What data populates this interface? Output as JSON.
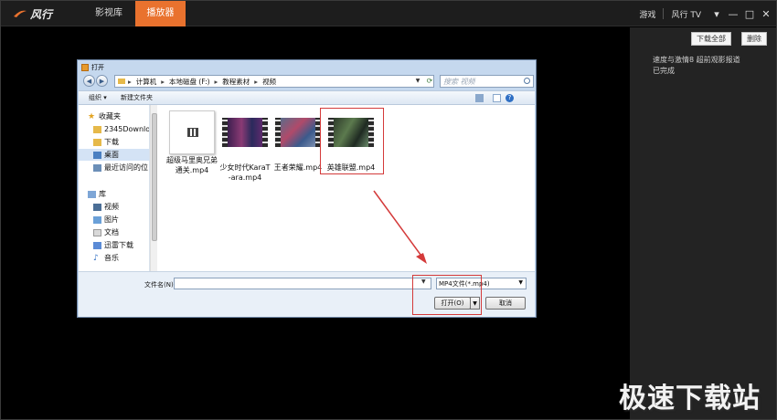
{
  "app": {
    "logo_text": "风行",
    "tabs": [
      {
        "label": "影视库"
      },
      {
        "label": "播放器"
      }
    ],
    "top_right": {
      "game": "游戏",
      "tv": "风行 TV"
    }
  },
  "right_panel": {
    "download_all": "下载全部",
    "delete": "删除",
    "item_title": "速度与激情8 超前观影报道",
    "item_status": "已完成"
  },
  "dialog": {
    "title": "打开",
    "breadcrumb": [
      "计算机",
      "本地磁盘 (F:)",
      "教程素材",
      "视频"
    ],
    "search_placeholder": "搜索 视频",
    "toolbar": {
      "organize": "组织 ▾",
      "new_folder": "新建文件夹"
    },
    "sidebar": [
      {
        "label": "收藏夹",
        "icon": "star-icon"
      },
      {
        "label": "2345Downlo",
        "icon": "folder-icon"
      },
      {
        "label": "下载",
        "icon": "folder-icon"
      },
      {
        "label": "桌面",
        "icon": "desktop-icon",
        "selected": true
      },
      {
        "label": "最近访问的位",
        "icon": "recent-icon"
      },
      {
        "label": "库",
        "icon": "library-icon"
      },
      {
        "label": "视频",
        "icon": "video-icon"
      },
      {
        "label": "图片",
        "icon": "picture-icon"
      },
      {
        "label": "文档",
        "icon": "document-icon"
      },
      {
        "label": "迅雷下载",
        "icon": "folder-icon"
      },
      {
        "label": "音乐",
        "icon": "music-icon"
      }
    ],
    "files": [
      {
        "name": "超级马里奥兄弟通关.mp4",
        "type": "document"
      },
      {
        "name": "少女时代KaraT-ara.mp4",
        "type": "video"
      },
      {
        "name": "王者荣耀.mp4",
        "type": "video"
      },
      {
        "name": "英雄联盟.mp4",
        "type": "video",
        "highlighted": true
      }
    ],
    "filename_label": "文件名(N):",
    "filename_value": "",
    "filetype": "MP4文件(*.mp4)",
    "open_button": "打开(O)",
    "cancel_button": "取消"
  },
  "watermark": "极速下载站",
  "colors": {
    "accent": "#e9722e",
    "highlight_red": "#d43a3a"
  }
}
